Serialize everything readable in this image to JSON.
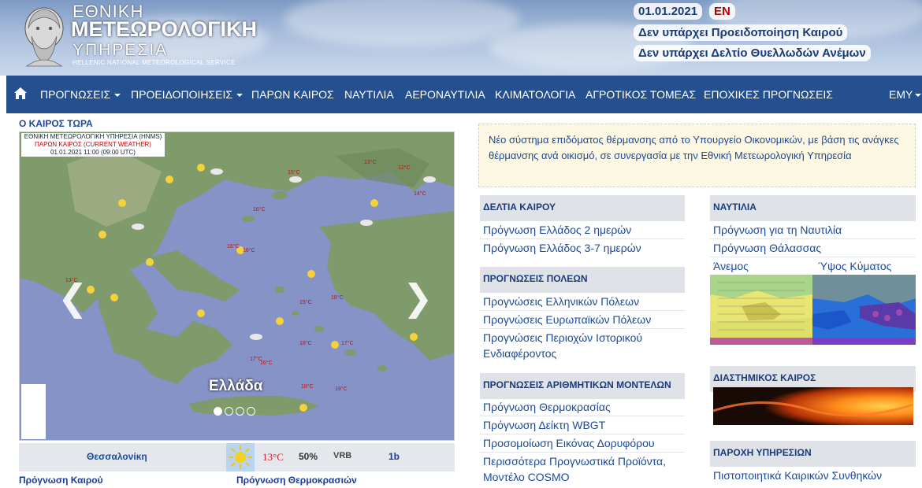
{
  "header": {
    "logo_line1": "ΕΘΝΙΚΗ",
    "logo_line2": "ΜΕΤΕΩΡΟΛΟΓΙΚΗ",
    "logo_line3": "ΥΠΗΡΕΣΙΑ",
    "logo_line4": "HELLENIC NATIONAL METEOROLOGICAL SERVICE",
    "date": "01.01.2021",
    "lang": "EN",
    "warning1": "Δεν υπάρχει Προειδοποίηση Καιρού",
    "warning2": "Δεν υπάρχει Δελτίο Θυελλωδών Ανέμων"
  },
  "nav": {
    "items": [
      {
        "label": "ΠΡΟΓΝΩΣΕΙΣ",
        "dropdown": true
      },
      {
        "label": "ΠΡΟΕΙΔΟΠΟΙΗΣΕΙΣ",
        "dropdown": true
      },
      {
        "label": "ΠΑΡΩΝ ΚΑΙΡΟΣ",
        "dropdown": false
      },
      {
        "label": "ΝΑΥΤΙΛΙΑ",
        "dropdown": false
      },
      {
        "label": "ΑΕΡΟΝΑΥΤΙΛΙΑ",
        "dropdown": false
      },
      {
        "label": "ΚΛΙΜΑΤΟΛΟΓΙΑ",
        "dropdown": false
      },
      {
        "label": "ΑΓΡΟΤΙΚΟΣ ΤΟΜΕΑΣ",
        "dropdown": false
      },
      {
        "label": "ΕΠΟΧΙΚΕΣ ΠΡΟΓΝΩΣΕΙΣ",
        "dropdown": false
      }
    ],
    "right_item": "ΕΜΥ"
  },
  "now": {
    "title": "Ο ΚΑΙΡΟΣ ΤΩΡΑ",
    "map_label_1": "ΕΘΝΙΚΗ ΜΕΤΕΩΡΟΛΟΓΙΚΗ ΥΠΗΡΕΣΙΑ (HNMS)",
    "map_label_2": "ΠΑΡΩΝ ΚΑΙΡΟΣ (CURRENT WEATHER)",
    "map_label_3": "01.01.2021 11:00 (09:00 UTC)",
    "slide_caption": "Ελλάδα",
    "arrow_prev": "❮",
    "arrow_next": "❯",
    "map_temps": [
      "16°C",
      "15°C",
      "13°C",
      "12°C",
      "14°C",
      "16°C",
      "16°C",
      "15°C",
      "17°C",
      "16°C",
      "18°C",
      "18°C",
      "19°C",
      "13°C",
      "17°C",
      "18°C"
    ],
    "city": {
      "name": "Θεσσαλονίκη",
      "temp": "13°C",
      "humidity": "50%",
      "wind_dir": "VRB",
      "wind_bf": "1b"
    },
    "link_forecast": "Πρόγνωση Καιρού",
    "link_temps": "Πρόγνωση Θερμοκρασιών"
  },
  "announcement": "Νέο σύστημα επιδόματος θέρμανσης από το Υπουργείο Οικονομικών, με βάση τις ανάγκες θέρμανσης ανά οικισμό, σε συνεργασία με την Εθνική Μετεωρολογική Υπηρεσία",
  "panels": {
    "deltia": {
      "title": "ΔΕΛΤΙΑ ΚΑΙΡΟΥ",
      "links": [
        "Πρόγνωση Ελλάδος 2 ημερών",
        "Πρόγνωση Ελλάδος 3-7 ημερών"
      ]
    },
    "poleis": {
      "title": "ΠΡΟΓΝΩΣΕΙΣ ΠΟΛΕΩΝ",
      "links": [
        "Προγνώσεις Ελληνικών Πόλεων",
        "Προγνώσεις Ευρωπαϊκών Πόλεων",
        "Προγνώσεις Περιοχών Ιστορικού Ενδιαφέροντος"
      ]
    },
    "models": {
      "title": "ΠΡΟΓΝΩΣΕΙΣ ΑΡΙΘΜΗΤΙΚΩΝ ΜΟΝΤΕΛΩΝ",
      "links": [
        "Πρόγνωση Θερμοκρασίας",
        "Πρόγνωση Δείκτη WBGT",
        "Προσομοίωση Εικόνας Δορυφόρου",
        "Περισσότερα Προγνωστικά Προϊόντα, Μοντέλο COSMO"
      ]
    },
    "nautilia": {
      "title": "ΝΑΥΤΙΛΙΑ",
      "links": [
        "Πρόγνωση για τη Ναυτιλία",
        "Πρόγνωση Θάλασσας"
      ],
      "wind_label": "Άνεμος",
      "wave_label": "Ύψος Κύματος"
    },
    "space": {
      "title": "ΔΙΑΣΤΗΜΙΚΟΣ ΚΑΙΡΟΣ"
    },
    "service": {
      "title": "ΠΑΡΟΧΗ ΥΠΗΡΕΣΙΩΝ",
      "links": [
        "Πιστοποιητικά Καιρικών Συνθηκών"
      ]
    }
  }
}
